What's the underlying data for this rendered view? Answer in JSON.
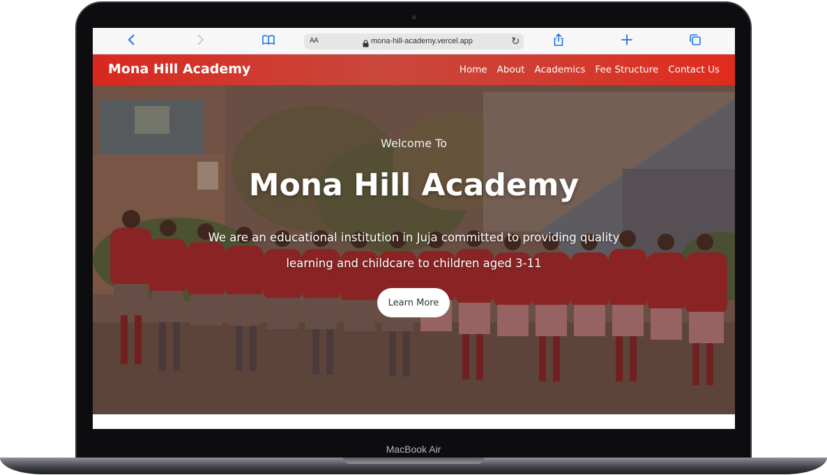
{
  "device": {
    "label": "MacBook Air"
  },
  "browser": {
    "text_size_label": "AA",
    "url": "mona-hill-academy.vercel.app",
    "icons": [
      "back-icon",
      "forward-icon",
      "bookmarks-icon",
      "lock-icon",
      "reload-icon",
      "share-icon",
      "new-tab-icon",
      "tabs-icon"
    ],
    "accent_color": "#1a73e8"
  },
  "site": {
    "logo": "Mona Hill Academy",
    "nav": [
      {
        "label": "Home"
      },
      {
        "label": "About"
      },
      {
        "label": "Academics"
      },
      {
        "label": "Fee Structure"
      },
      {
        "label": "Contact Us"
      }
    ],
    "brand_color": "#d9281f",
    "hero": {
      "welcome": "Welcome To",
      "title": "Mona Hill Academy",
      "description": "We are an educational institution in Juja committed to providing quality learning and childcare to children aged 3-11",
      "cta": "Learn More"
    }
  }
}
